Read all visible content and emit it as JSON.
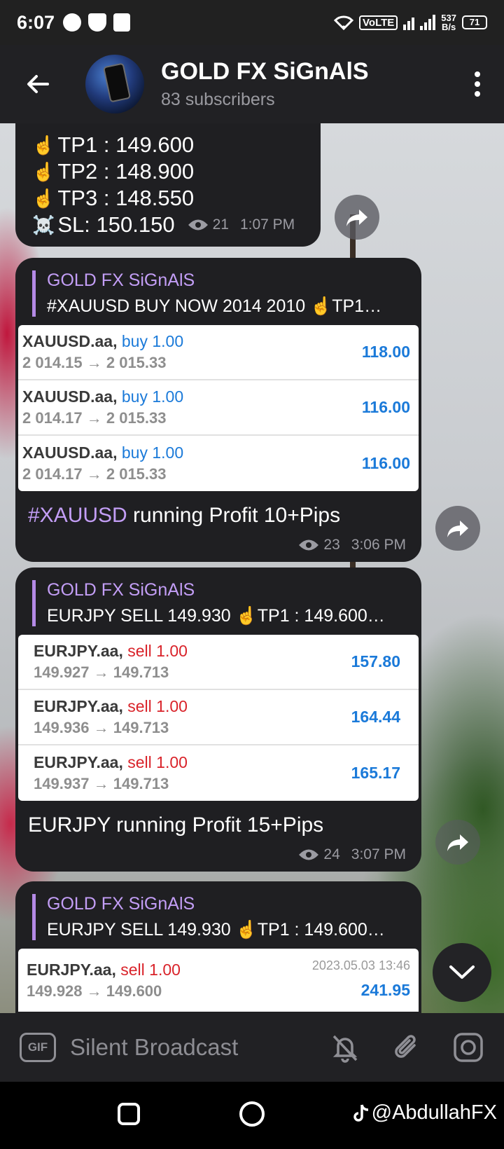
{
  "status_bar": {
    "time": "6:07",
    "network": "VoLTE",
    "speed_value": "537",
    "speed_unit": "B/s",
    "battery": "71"
  },
  "header": {
    "title": "GOLD FX SiGnAlS",
    "subtitle": "83 subscribers"
  },
  "message1": {
    "lines": [
      {
        "emoji": "☝️",
        "text": "TP1 : 149.600"
      },
      {
        "emoji": "☝️",
        "text": "TP2 : 148.900"
      },
      {
        "emoji": "☝️",
        "text": "TP3 : 148.550"
      },
      {
        "emoji": "☠️",
        "text": "SL: 150.150"
      }
    ],
    "views": "21",
    "time": "1:07 PM"
  },
  "message2": {
    "reply_name": "GOLD FX SiGnAlS",
    "reply_text": "#XAUUSD BUY NOW 2014 2010  ☝️TP1…",
    "trades": [
      {
        "symbol": "XAUUSD.aa,",
        "side": "buy 1.00",
        "prices": "2 014.15 → 2 015.33",
        "profit": "118.00"
      },
      {
        "symbol": "XAUUSD.aa,",
        "side": "buy 1.00",
        "prices": "2 014.17 → 2 015.33",
        "profit": "116.00"
      },
      {
        "symbol": "XAUUSD.aa,",
        "side": "buy 1.00",
        "prices": "2 014.17 → 2 015.33",
        "profit": "116.00"
      }
    ],
    "caption_tag": "#XAUUSD",
    "caption_text": " running Profit 10+Pips",
    "views": "23",
    "time": "3:06 PM"
  },
  "message3": {
    "reply_name": "GOLD FX SiGnAlS",
    "reply_text": "EURJPY SELL 149.930  ☝️TP1 : 149.600…",
    "trades": [
      {
        "symbol": "EURJPY.aa,",
        "side": "sell 1.00",
        "prices": "149.927 → 149.713",
        "profit": "157.80"
      },
      {
        "symbol": "EURJPY.aa,",
        "side": "sell 1.00",
        "prices": "149.936 → 149.713",
        "profit": "164.44"
      },
      {
        "symbol": "EURJPY.aa,",
        "side": "sell 1.00",
        "prices": "149.937 → 149.713",
        "profit": "165.17"
      }
    ],
    "caption": "EURJPY running Profit 15+Pips",
    "views": "24",
    "time": "3:07 PM"
  },
  "message4": {
    "reply_name": "GOLD FX SiGnAlS",
    "reply_text": "EURJPY SELL 149.930  ☝️TP1 : 149.600…",
    "trade": {
      "symbol": "EURJPY.aa,",
      "side": "sell 1.00",
      "prices": "149.928 → 149.600",
      "date": "2023.05.03 13:46",
      "profit": "241.95"
    }
  },
  "input_bar": {
    "gif_label": "GIF",
    "placeholder": "Silent Broadcast"
  },
  "watermark": "@AbdullahFX",
  "colors": {
    "accent": "#c39ef6",
    "bubble": "#1f1f22",
    "buy": "#1b7ad9",
    "sell": "#d9232a"
  }
}
